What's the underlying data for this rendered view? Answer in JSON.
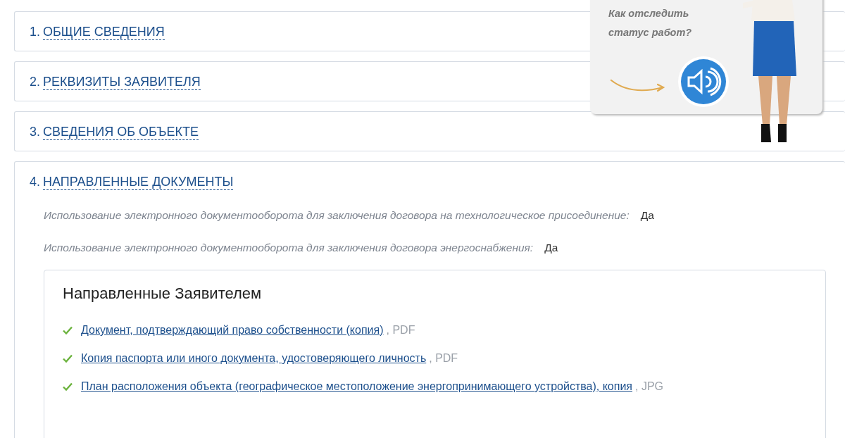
{
  "sections": [
    {
      "number": "1.",
      "title": "ОБЩИЕ СВЕДЕНИЯ"
    },
    {
      "number": "2.",
      "title": "РЕКВИЗИТЫ ЗАЯВИТЕЛЯ"
    },
    {
      "number": "3.",
      "title": "СВЕДЕНИЯ ОБ ОБЪЕКТЕ"
    },
    {
      "number": "4.",
      "title": "НАПРАВЛЕННЫЕ ДОКУМЕНТЫ",
      "fields": [
        {
          "label": "Использование электронного документооборота для заключения договора на технологическое присоединение:",
          "value": "Да"
        },
        {
          "label": "Использование электронного документооборота для заключения договора энергоснабжения:",
          "value": "Да"
        }
      ],
      "documents_panel": {
        "title": "Направленные Заявителем",
        "documents": [
          {
            "name": "Документ, подтверждающий право собственности (копия)",
            "format": ", PDF",
            "checked": true
          },
          {
            "name": "Копия паспорта или иного документа, удостоверяющего личность",
            "format": ", PDF",
            "checked": true
          },
          {
            "name": "План расположения объекта (географическое местоположение энергопринимающего устройства), копия",
            "format": ", JPG",
            "checked": true
          }
        ]
      }
    }
  ],
  "help_widget": {
    "question": "Как отследить статус работ?"
  }
}
